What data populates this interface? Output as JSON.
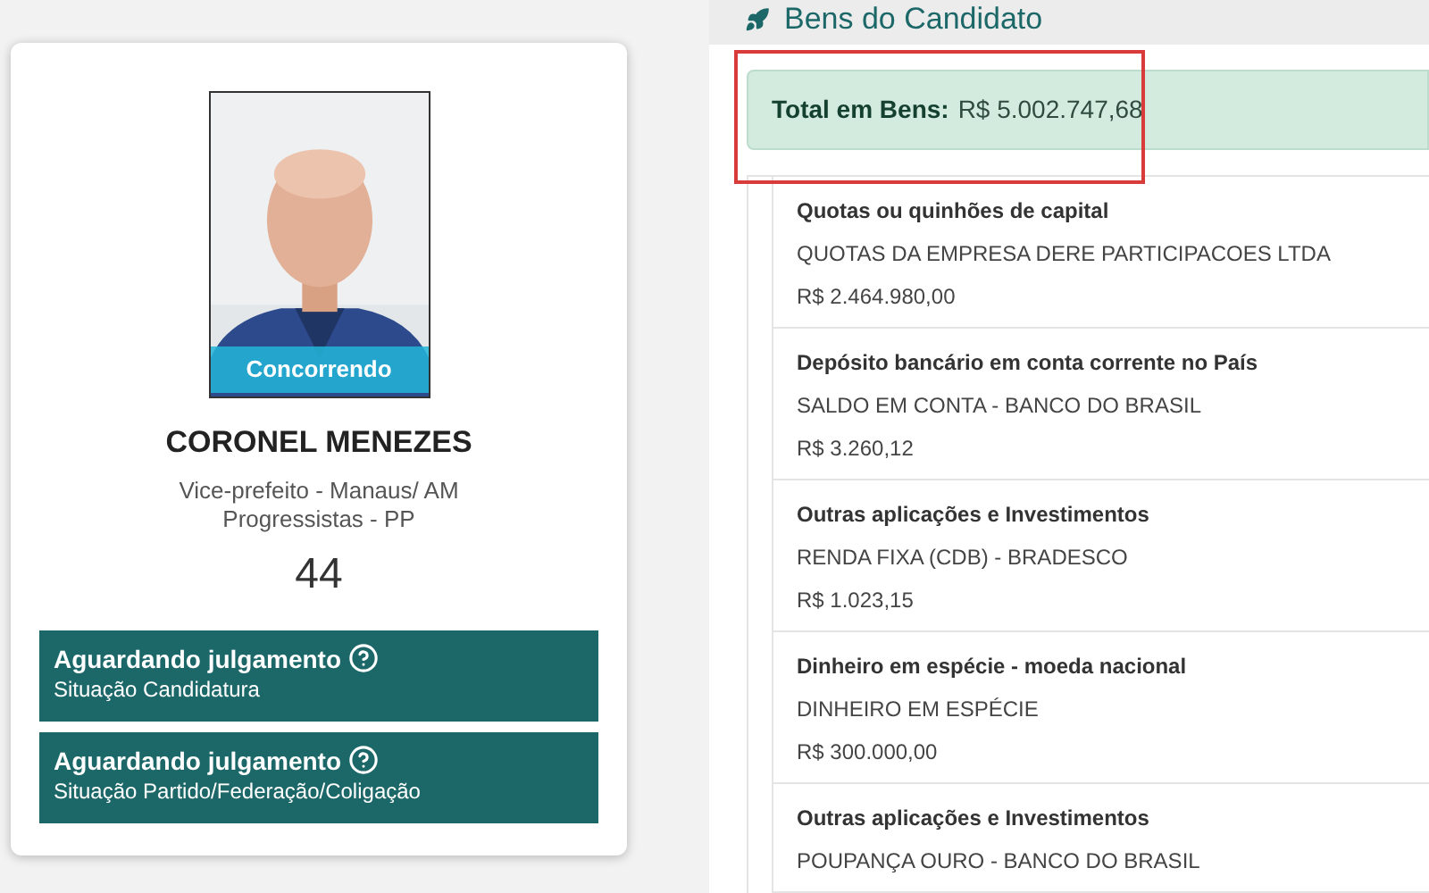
{
  "candidate": {
    "photo_badge": "Concorrendo",
    "name": "CORONEL MENEZES",
    "role": "Vice-prefeito - Manaus/ AM",
    "party": "Progressistas - PP",
    "number": "44",
    "statuses": [
      {
        "value": "Aguardando julgamento",
        "label": "Situação Candidatura"
      },
      {
        "value": "Aguardando julgamento",
        "label": "Situação Partido/Federação/Coligação"
      }
    ]
  },
  "assets": {
    "title": "Bens do Candidato",
    "total_label": "Total em Bens:",
    "total_value": "R$ 5.002.747,68",
    "total_highlighted": true,
    "items": [
      {
        "type": "Quotas ou quinhões de capital",
        "description": "QUOTAS DA EMPRESA DERE PARTICIPACOES LTDA",
        "value": "R$ 2.464.980,00"
      },
      {
        "type": "Depósito bancário em conta corrente no País",
        "description": "SALDO EM CONTA - BANCO DO BRASIL",
        "value": "R$ 3.260,12"
      },
      {
        "type": "Outras aplicações e Investimentos",
        "description": "RENDA FIXA (CDB) - BRADESCO",
        "value": "R$ 1.023,15"
      },
      {
        "type": "Dinheiro em espécie - moeda nacional",
        "description": "DINHEIRO EM ESPÉCIE",
        "value": "R$ 300.000,00"
      },
      {
        "type": "Outras aplicações e Investimentos",
        "description": "POUPANÇA OURO - BANCO DO BRASIL"
      }
    ]
  }
}
